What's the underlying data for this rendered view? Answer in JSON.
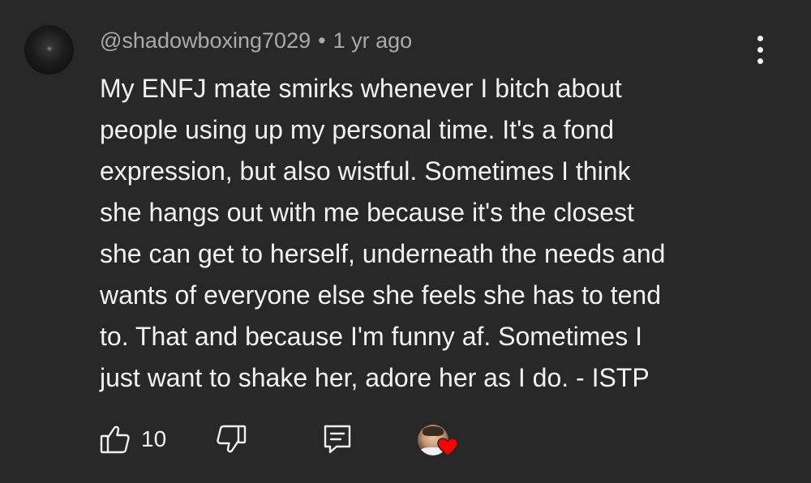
{
  "comment": {
    "author": "@shadowboxing7029",
    "separator": "•",
    "time": "1 yr ago",
    "text": "My ENFJ mate smirks whenever I bitch about\npeople using up my personal time. It's a fond\nexpression, but also wistful. Sometimes I think\nshe hangs out with me because it's the closest\nshe can get to herself, underneath the needs and\nwants of everyone else she feels she has to tend\nto. That and because I'm funny af. Sometimes I\njust want to shake her, adore her as I do.  - ISTP",
    "like_count": "10"
  },
  "icons": {
    "avatar": "user-avatar",
    "more": "more-vertical-icon",
    "like": "thumbs-up-icon",
    "dislike": "thumbs-down-icon",
    "reply": "reply-comment-icon",
    "creator_heart": "heart-icon"
  },
  "colors": {
    "background": "#282828",
    "primary_text": "#f1f1f1",
    "secondary_text": "#aaaaaa",
    "heart": "#ff0000"
  }
}
